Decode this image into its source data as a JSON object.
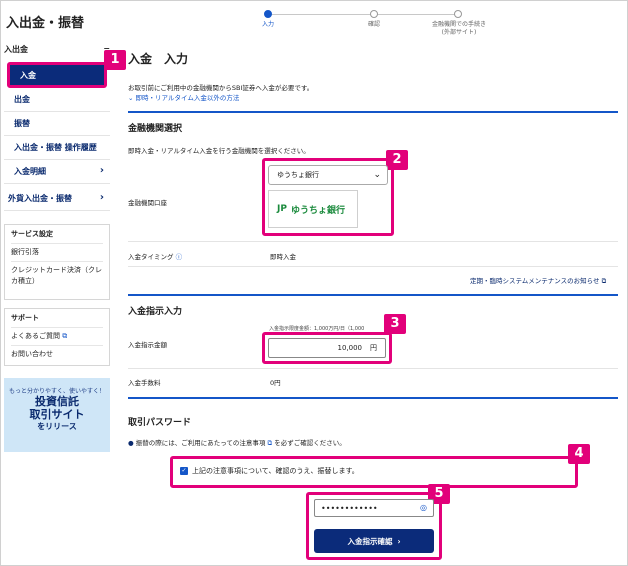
{
  "page_title": "入出金・振替",
  "sidebar": {
    "group_label": "入出金",
    "collapse_symbol": "−",
    "items": [
      {
        "label": "入金",
        "active": true
      },
      {
        "label": "出金"
      },
      {
        "label": "振替"
      },
      {
        "label": "入出金・振替 操作履歴"
      },
      {
        "label": "入金明細"
      },
      {
        "label": "外貨入出金・振替"
      }
    ],
    "service_box": {
      "title": "サービス設定",
      "links": [
        "銀行引落",
        "クレジットカード決済（クレカ積立）"
      ]
    },
    "support_box": {
      "title": "サポート",
      "links": [
        "よくあるご質問",
        "お問い合わせ"
      ]
    },
    "banner": {
      "line1": "もっと分かりやすく、使いやすく！",
      "line2": "投資信託",
      "line3": "取引サイト",
      "line4": "をリリース"
    }
  },
  "stepper": {
    "steps": [
      {
        "label": "入力",
        "active": true
      },
      {
        "label": "確認"
      },
      {
        "label": "金融機関での手続き\n(外部サイト)"
      }
    ]
  },
  "main": {
    "title": "入金　入力",
    "notice": "お取引前にご利用中の金融機関からSBI証券へ入金が必要です。",
    "notice_link": "即時・リアルタイム入金以外の方法",
    "bank_section": {
      "title": "金融機関選択",
      "desc": "即時入金・リアルタイム入金を行う金融機関を選択ください。",
      "label": "金融機関口座",
      "selected_bank": "ゆうちょ銀行",
      "logo_text": "ゆうちょ銀行",
      "timing_label": "入金タイミング",
      "timing_value": "即時入金",
      "maintenance_link": "定期・臨時システムメンテナンスのお知らせ"
    },
    "amount_section": {
      "title": "入金指示入力",
      "limit_note": "入金指示限度金額：1,000万円/日（1,000",
      "amount_label": "入金指示金額",
      "amount_value": "10,000",
      "unit": "円",
      "fee_label": "入金手数料",
      "fee_value": "0円"
    },
    "password_section": {
      "title": "取引パスワード",
      "caution_text": "振替の際には、ご利用にあたっての注意事項",
      "caution_suffix": "を必ずご確認ください。",
      "checkbox_label": "上記の注意事項について、確認のうえ、振替します。",
      "password_dots": "••••••••••••",
      "submit_label": "入金指示確認"
    }
  },
  "badges": [
    "1",
    "2",
    "3",
    "4",
    "5"
  ],
  "colors": {
    "accent_pink": "#e2007a",
    "navy": "#0b2b7a",
    "link_blue": "#1456c8"
  }
}
